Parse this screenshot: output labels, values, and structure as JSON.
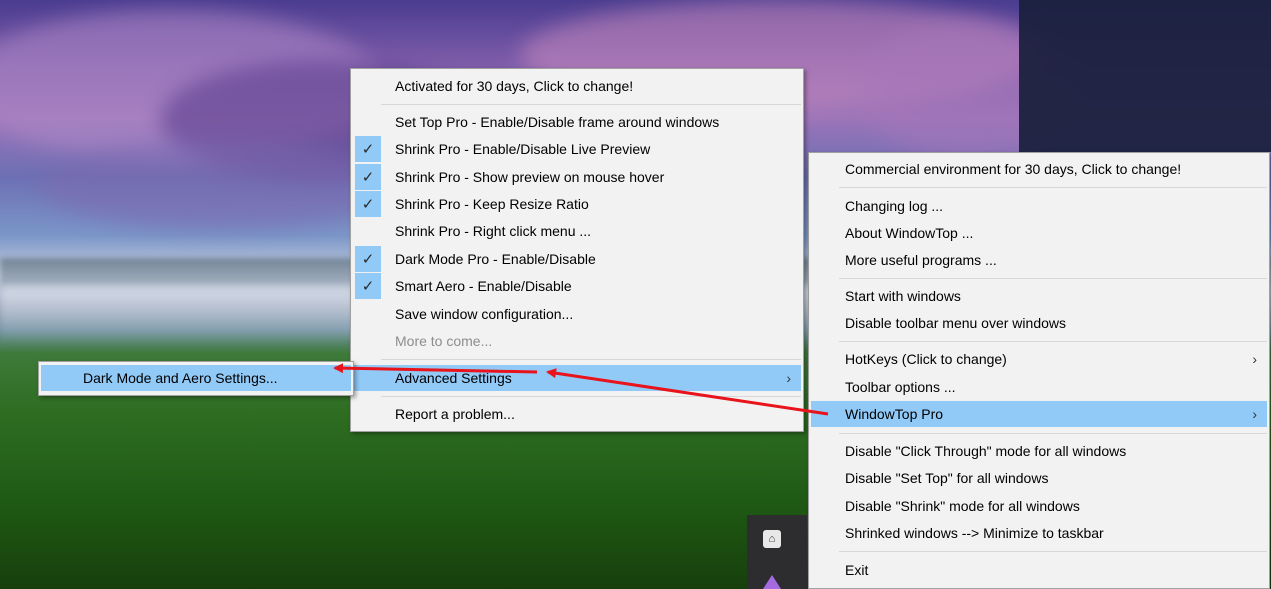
{
  "desktop": {
    "tray_icons": [
      "lock-icon",
      "app-icon"
    ]
  },
  "main_menu": {
    "items": [
      {
        "label": "Commercial environment for 30 days, Click to change!"
      },
      {
        "label": "Changing log ..."
      },
      {
        "label": "About WindowTop ..."
      },
      {
        "label": "More useful programs ..."
      },
      {
        "label": "Start with windows"
      },
      {
        "label": "Disable toolbar menu over windows"
      },
      {
        "label": "HotKeys (Click to change)",
        "submenu": true
      },
      {
        "label": "Toolbar options ..."
      },
      {
        "label": "WindowTop Pro",
        "submenu": true,
        "highlighted": true
      },
      {
        "label": "Disable \"Click Through\" mode for all windows"
      },
      {
        "label": "Disable \"Set Top\" for all windows"
      },
      {
        "label": "Disable \"Shrink\" mode for all windows"
      },
      {
        "label": "Shrinked windows --> Minimize to taskbar"
      },
      {
        "label": "Exit"
      }
    ],
    "chevron": "›"
  },
  "pro_menu": {
    "items": [
      {
        "label": "Activated for 30 days, Click to change!"
      },
      {
        "label": "Set Top Pro - Enable/Disable frame around windows",
        "checked": false
      },
      {
        "label": "Shrink Pro - Enable/Disable Live Preview",
        "checked": true
      },
      {
        "label": "Shrink Pro - Show preview on mouse hover",
        "checked": true
      },
      {
        "label": "Shrink Pro - Keep Resize Ratio",
        "checked": true
      },
      {
        "label": "Shrink Pro - Right click menu ...",
        "checked": false
      },
      {
        "label": "Dark Mode Pro - Enable/Disable",
        "checked": true
      },
      {
        "label": "Smart Aero - Enable/Disable",
        "checked": true
      },
      {
        "label": "Save window configuration..."
      },
      {
        "label": "More to come...",
        "disabled": true
      },
      {
        "label": "Advanced Settings",
        "submenu": true,
        "highlighted": true
      },
      {
        "label": "Report a problem..."
      }
    ],
    "check_glyph": "✓",
    "chevron": "›"
  },
  "advanced_menu": {
    "items": [
      {
        "label": "Dark Mode and Aero Settings...",
        "highlighted": true
      }
    ]
  },
  "colors": {
    "highlight": "#91c9f7",
    "menu_bg": "#f2f2f2",
    "arrow": "#e8131b"
  }
}
